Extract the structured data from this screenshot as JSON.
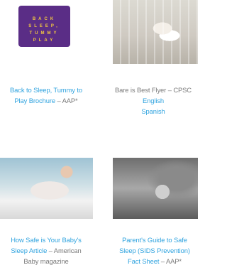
{
  "brochure_tile": {
    "words": [
      "BACK",
      "SLEEP,",
      "TUMMY",
      "PLAY"
    ],
    "colors": {
      "tile": "#5a2d86",
      "letters": "#f3c940"
    }
  },
  "items": [
    {
      "thumb": "brochure-thumbnail",
      "caption": [
        {
          "text": "Back to Sleep, Tummy to",
          "link": true
        },
        {
          "text": "Play Brochure",
          "link": true,
          "suffix": " – AAP*"
        }
      ]
    },
    {
      "thumb": "baby-in-crib-photo",
      "caption": [
        {
          "text": "Bare is Best Flyer – CPSC",
          "link": false
        },
        {
          "text": "English",
          "link": true
        },
        {
          "text": "Spanish",
          "link": true
        }
      ]
    },
    {
      "thumb": "baby-on-bed-photo",
      "caption": [
        {
          "text": "How Safe is Your Baby's",
          "link": true
        },
        {
          "text": "Sleep Article",
          "link": true,
          "suffix": " – American"
        },
        {
          "text": "Baby magazine",
          "link": false
        }
      ]
    },
    {
      "thumb": "baby-black-white-photo",
      "caption": [
        {
          "text": "Parent's Guide to Safe",
          "link": true
        },
        {
          "text": "Sleep (SIDS Prevention)",
          "link": true
        },
        {
          "text": "Fact Sheet",
          "link": true,
          "suffix": " – AAP*"
        }
      ]
    }
  ],
  "colors": {
    "link": "#2fa3df",
    "text": "#7a7a7a"
  }
}
